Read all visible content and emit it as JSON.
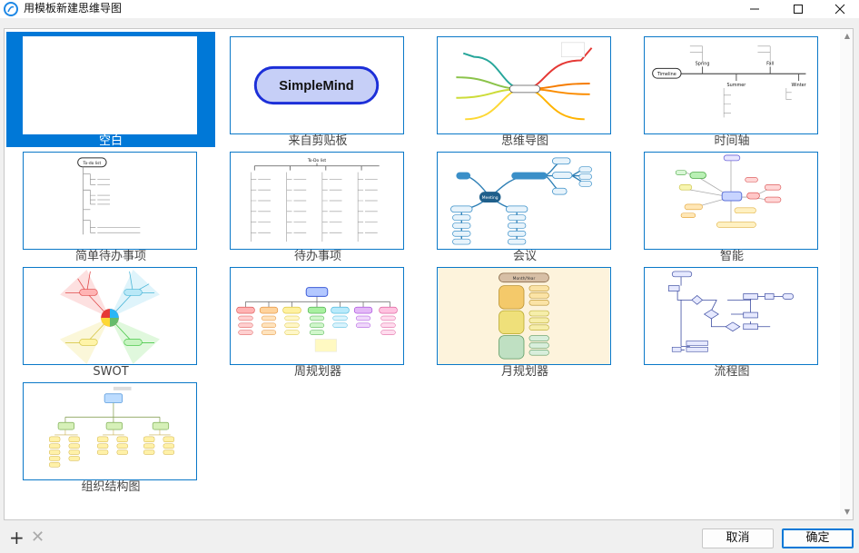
{
  "window": {
    "title": "用模板新建思维导图",
    "icon": "simplemind-app-icon",
    "controls": [
      "minimize-icon",
      "maximize-icon",
      "close-icon"
    ]
  },
  "templates": [
    {
      "label": "空白",
      "selected": true
    },
    {
      "label": "来自剪贴板",
      "selected": false,
      "preview_text": "SimpleMind"
    },
    {
      "label": "思维导图",
      "selected": false
    },
    {
      "label": "时间轴",
      "selected": false,
      "preview": {
        "root": "Timeline",
        "nodes": [
          "Spring",
          "Summer",
          "Fall",
          "Winter"
        ]
      }
    },
    {
      "label": "简单待办事项",
      "selected": false,
      "preview": {
        "root": "To-do list"
      }
    },
    {
      "label": "待办事项",
      "selected": false,
      "preview": {
        "root": "To-Do list"
      }
    },
    {
      "label": "会议",
      "selected": false,
      "preview": {
        "root": "Meeting"
      }
    },
    {
      "label": "智能",
      "selected": false
    },
    {
      "label": "SWOT",
      "selected": false
    },
    {
      "label": "周规划器",
      "selected": false
    },
    {
      "label": "月规划器",
      "selected": false,
      "preview": {
        "root": "Month/Year"
      }
    },
    {
      "label": "流程图",
      "selected": false
    },
    {
      "label": "组织结构图",
      "selected": false
    }
  ],
  "toolbar": {
    "add_icon": "plus-icon",
    "remove_icon": "cross-icon",
    "plus_glyph": "+",
    "cross_glyph": "✕"
  },
  "buttons": {
    "cancel": "取消",
    "ok": "确定"
  }
}
